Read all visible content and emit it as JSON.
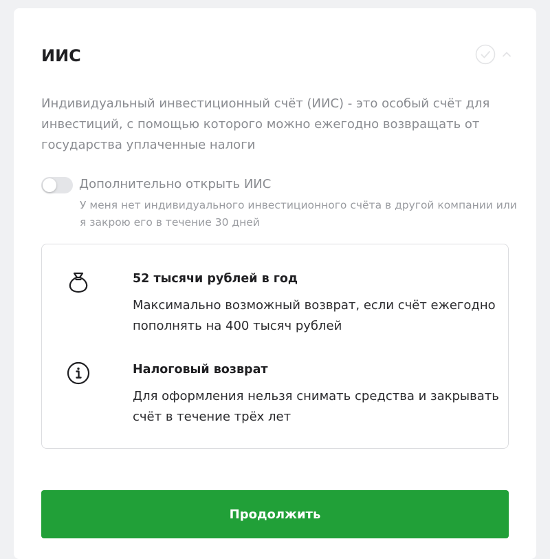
{
  "section": {
    "title": "ИИС",
    "status_icons": [
      "check-circle-icon",
      "chevron-up-icon"
    ],
    "description": "Индивидуальный инвестиционный счёт (ИИС) - это особый счёт для инвестиций, с помощью которого можно ежегодно возвращать от государства уплаченные налоги"
  },
  "toggle": {
    "label": "Дополнительно открыть ИИС",
    "sublabel": "У меня нет индивидуального инвестиционного счёта в другой компании или я закрою его в течение 30 дней",
    "checked": false
  },
  "info": {
    "items": [
      {
        "icon": "money-bag-icon",
        "title": "52 тысячи рублей в год",
        "text": "Максимально возможный возврат, если счёт ежегодно пополнять на 400 тысяч рублей"
      },
      {
        "icon": "info-icon",
        "title": "Налоговый возврат",
        "text": "Для оформления нельзя снимать средства и закрывать счёт в течение трёх лет"
      }
    ]
  },
  "actions": {
    "continue_label": "Продолжить"
  },
  "colors": {
    "accent": "#21a038",
    "muted_text": "#8a8c91",
    "border": "#dcdde0"
  }
}
